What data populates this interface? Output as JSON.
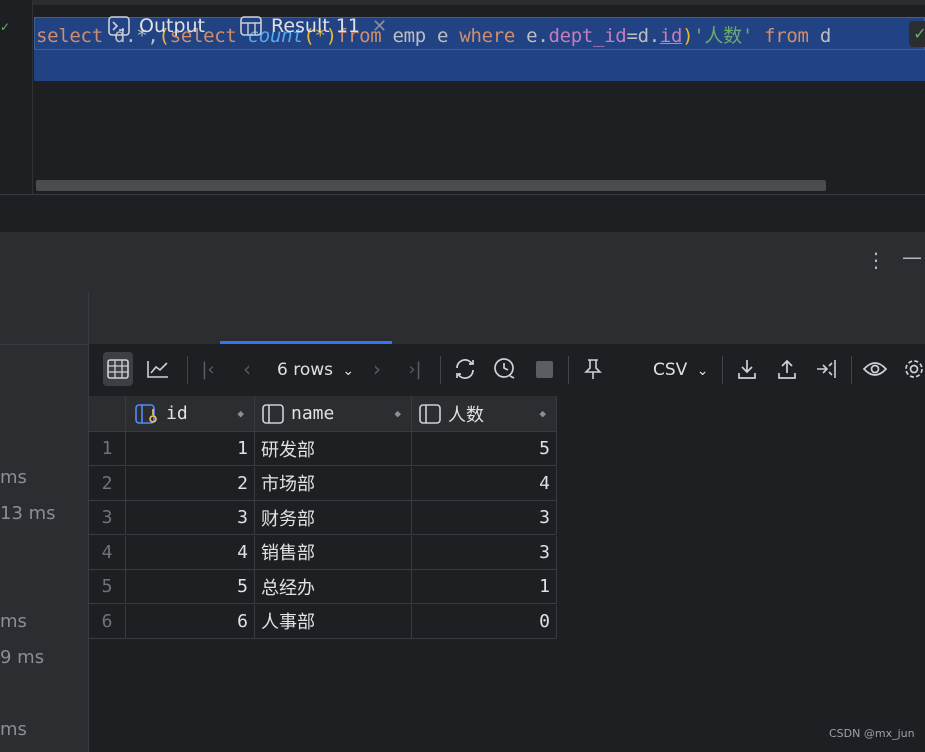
{
  "editor": {
    "code_tokens": [
      {
        "t": "select",
        "c": "kw"
      },
      {
        "t": " d.*,",
        "c": "pl"
      },
      {
        "t": "(",
        "c": "paren"
      },
      {
        "t": "select",
        "c": "kw"
      },
      {
        "t": "  ",
        "c": "pl"
      },
      {
        "t": "count",
        "c": "fn"
      },
      {
        "t": "(*)",
        "c": "paren"
      },
      {
        "t": "from",
        "c": "kw"
      },
      {
        "t": " emp e ",
        "c": "pl"
      },
      {
        "t": "where",
        "c": "kw"
      },
      {
        "t": "  e.",
        "c": "pl"
      },
      {
        "t": "dept_id",
        "c": "fld"
      },
      {
        "t": "=d.",
        "c": "pl"
      },
      {
        "t": "id",
        "c": "fldu"
      },
      {
        "t": ")",
        "c": "paren"
      },
      {
        "t": "'人数'",
        "c": "str"
      },
      {
        "t": " ",
        "c": "pl"
      },
      {
        "t": "from",
        "c": "kw"
      },
      {
        "t": " d",
        "c": "pl"
      }
    ]
  },
  "left_pane": {
    "timings": [
      "ms",
      "13 ms",
      "ms",
      "9 ms",
      "ms"
    ]
  },
  "tabs": {
    "output_label": "Output",
    "result_label": "Result 11",
    "close_glyph": "✕"
  },
  "toolbar": {
    "rows_label": "6 rows",
    "export_format": "CSV"
  },
  "grid": {
    "columns": [
      {
        "label": "id",
        "icon": "key-column-icon"
      },
      {
        "label": "name",
        "icon": "column-icon"
      },
      {
        "label": "人数",
        "icon": "column-icon"
      }
    ],
    "rows": [
      {
        "n": "1",
        "id": "1",
        "name": "研发部",
        "count": "5"
      },
      {
        "n": "2",
        "id": "2",
        "name": "市场部",
        "count": "4"
      },
      {
        "n": "3",
        "id": "3",
        "name": "财务部",
        "count": "3"
      },
      {
        "n": "4",
        "id": "4",
        "name": "销售部",
        "count": "3"
      },
      {
        "n": "5",
        "id": "5",
        "name": "总经办",
        "count": "1"
      },
      {
        "n": "6",
        "id": "6",
        "name": "人事部",
        "count": "0"
      }
    ]
  },
  "watermark": "CSDN @mx_jun"
}
